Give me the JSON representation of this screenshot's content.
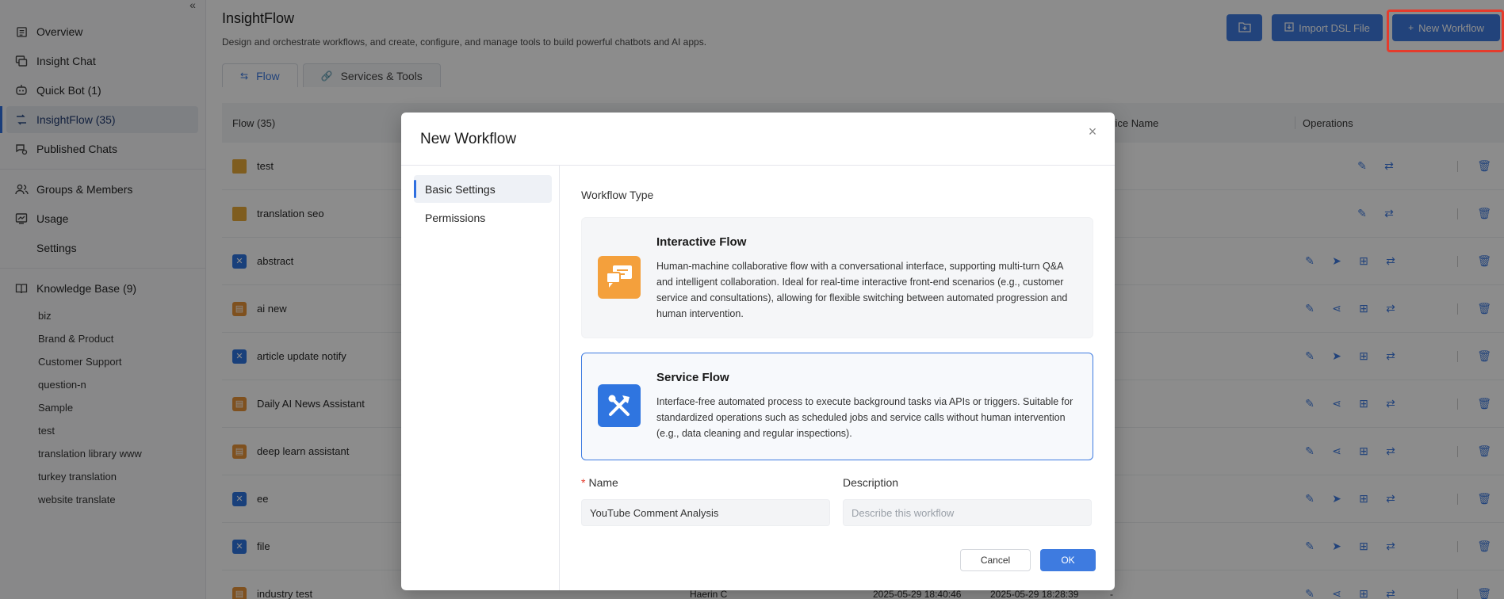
{
  "sidebar": {
    "items": [
      {
        "label": "Overview",
        "icon": "document-icon"
      },
      {
        "label": "Insight Chat",
        "icon": "chat-icon"
      },
      {
        "label": "Quick Bot (1)",
        "icon": "robot-icon"
      },
      {
        "label": "InsightFlow  (35)",
        "icon": "flow-icon",
        "active": true
      },
      {
        "label": "Published Chats",
        "icon": "published-chat-icon"
      },
      {
        "label": "Groups & Members",
        "icon": "users-icon"
      },
      {
        "label": "Usage",
        "icon": "chart-icon"
      },
      {
        "label": "Settings",
        "icon": ""
      }
    ],
    "knowledge_base": {
      "label": "Knowledge Base (9)",
      "items": [
        "biz",
        "Brand & Product",
        "Customer Support",
        "question-n",
        "Sample",
        "test",
        "translation library www",
        "turkey translation",
        "website translate"
      ]
    }
  },
  "header": {
    "title": "InsightFlow",
    "description": "Design and orchestrate workflows, and create, configure, and manage tools to build powerful chatbots and AI apps.",
    "import_label": "Import DSL File",
    "new_workflow_label": "New Workflow"
  },
  "tabs": [
    {
      "label": "Flow",
      "active": true
    },
    {
      "label": "Services & Tools",
      "active": false
    }
  ],
  "table": {
    "columns": {
      "flow": "Flow (35)",
      "service_name": "vice Name",
      "operations": "Operations"
    },
    "rows": [
      {
        "name": "test",
        "type": "folder"
      },
      {
        "name": "translation seo",
        "type": "folder"
      },
      {
        "name": "abstract",
        "type": "service"
      },
      {
        "name": "ai new",
        "type": "interactive"
      },
      {
        "name": "article update notify",
        "type": "service"
      },
      {
        "name": "Daily AI News Assistant",
        "type": "interactive"
      },
      {
        "name": "deep learn assistant",
        "type": "interactive"
      },
      {
        "name": "ee",
        "type": "service"
      },
      {
        "name": "file",
        "type": "service"
      },
      {
        "name": "industry test",
        "type": "interactive",
        "creator": "Haerin C",
        "created": "2025-05-29 18:40:46",
        "updated": "2025-05-29 18:28:39",
        "service": "-"
      }
    ]
  },
  "modal": {
    "title": "New Workflow",
    "side": [
      "Basic Settings",
      "Permissions"
    ],
    "workflow_type_label": "Workflow Type",
    "interactive": {
      "title": "Interactive Flow",
      "desc": "Human-machine collaborative flow with a conversational interface, supporting multi-turn Q&A and intelligent collaboration. Ideal for real-time interactive front-end scenarios (e.g., customer service and consultations), allowing for flexible switching between automated progression and human intervention."
    },
    "service": {
      "title": "Service Flow",
      "desc": "Interface-free automated process to execute background tasks via APIs or triggers. Suitable for standardized operations such as scheduled jobs and service calls without human intervention (e.g., data cleaning and regular inspections)."
    },
    "name_label": "Name",
    "name_value": "YouTube Comment Analysis",
    "desc_label": "Description",
    "desc_placeholder": "Describe this workflow",
    "cancel": "Cancel",
    "ok": "OK"
  },
  "colors": {
    "accent": "#3e7be0",
    "highlight": "#e53b2c",
    "arrow": "#e5432f",
    "interactive_icon": "#f4a03c",
    "service_icon": "#2f75e0"
  }
}
